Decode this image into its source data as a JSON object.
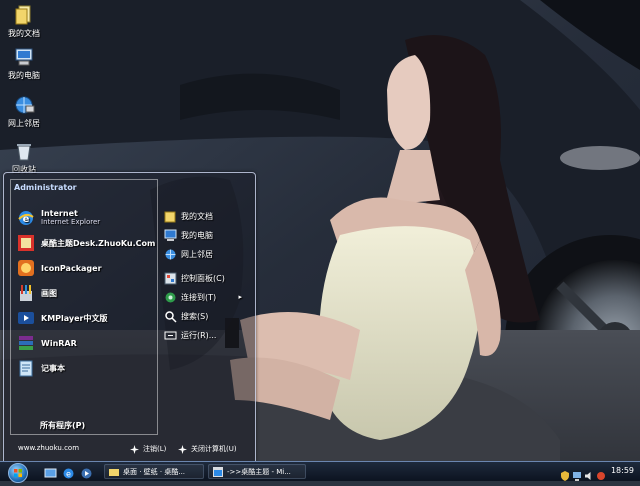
{
  "desktop": {
    "icons": [
      {
        "label": "我的文档",
        "icon": "folder-documents-icon"
      },
      {
        "label": "我的电脑",
        "icon": "computer-icon"
      },
      {
        "label": "网上邻居",
        "icon": "network-icon"
      },
      {
        "label": "回收站",
        "icon": "recycle-bin-icon"
      }
    ]
  },
  "start_menu": {
    "user": "Administrator",
    "programs": [
      {
        "label": "Internet",
        "sub": "Internet Explorer",
        "icon": "internet-explorer-icon"
      },
      {
        "label": "桌酷主题Desk.ZhuoKu.Com",
        "icon": "zhuoku-icon"
      },
      {
        "label": "IconPackager",
        "icon": "iconpackager-icon"
      },
      {
        "label": "画图",
        "icon": "paint-icon"
      },
      {
        "label": "KMPlayer中文版",
        "icon": "kmplayer-icon"
      },
      {
        "label": "WinRAR",
        "icon": "winrar-icon"
      },
      {
        "label": "记事本",
        "icon": "notepad-icon"
      }
    ],
    "all_programs": "所有程序(P)",
    "places": [
      {
        "label": "我的文档",
        "icon": "folder-documents-icon"
      },
      {
        "label": "我的电脑",
        "icon": "computer-icon"
      },
      {
        "label": "网上邻居",
        "icon": "network-icon"
      },
      {
        "label": "控制面板(C)",
        "icon": "control-panel-icon"
      },
      {
        "label": "连接到(T)",
        "icon": "connect-icon",
        "arrow": "▸"
      },
      {
        "label": "搜索(S)",
        "icon": "search-icon"
      },
      {
        "label": "运行(R)...",
        "icon": "run-icon"
      }
    ],
    "url": "www.zhuoku.com",
    "logoff": "注销(L)",
    "shutdown": "关闭计算机(U)"
  },
  "taskbar": {
    "tasks": [
      {
        "label": "桌面 · 壁纸 · 桌酷...",
        "icon": "folder-icon"
      },
      {
        "label": "->>桌酷主题 - Mi...",
        "icon": "browser-icon"
      }
    ],
    "clock": "18:59"
  },
  "colors": {
    "accent": "#1f6fb8",
    "menu_border": "#dce6ff"
  }
}
